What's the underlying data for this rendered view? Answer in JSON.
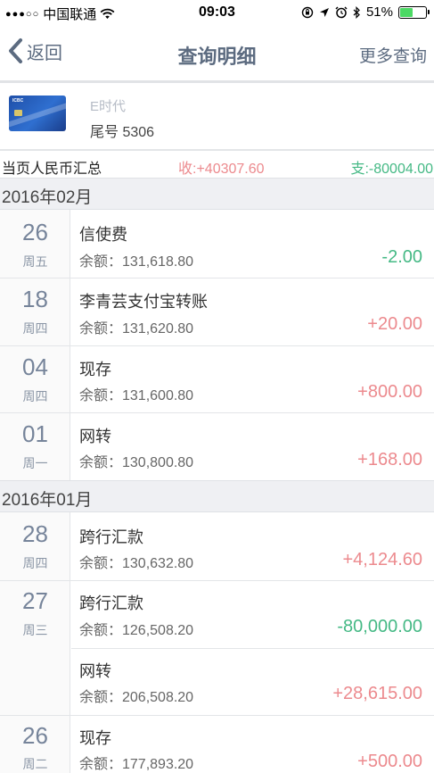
{
  "status_bar": {
    "signal": "●●●○○",
    "carrier": "中国联通",
    "time": "09:03",
    "battery_text": "51%",
    "battery_level": 0.51,
    "battery_color": "#4cd964"
  },
  "nav": {
    "back_label": "返回",
    "title": "查询明细",
    "more_label": "更多查询"
  },
  "card": {
    "name": "E时代",
    "tail": "尾号 5306",
    "logo_text": "ICBC"
  },
  "summary": {
    "label": "当页人民币汇总",
    "income": "收:+40307.60",
    "expense": "支:-80004.00"
  },
  "months": {
    "feb": "2016年02月",
    "jan": "2016年01月"
  },
  "transactions": [
    {
      "day": "26",
      "weekday": "周五",
      "title": "信使费",
      "balance": "余额：131,618.80",
      "amount": "-2.00"
    },
    {
      "day": "18",
      "weekday": "周四",
      "title": "李青芸支付宝转账",
      "balance": "余额：131,620.80",
      "amount": "+20.00"
    },
    {
      "day": "04",
      "weekday": "周四",
      "title": "现存",
      "balance": "余额：131,600.80",
      "amount": "+800.00"
    },
    {
      "day": "01",
      "weekday": "周一",
      "title": "网转",
      "balance": "余额：130,800.80",
      "amount": "+168.00"
    },
    {
      "day": "28",
      "weekday": "周四",
      "title": "跨行汇款",
      "balance": "余额：130,632.80",
      "amount": "+4,124.60"
    },
    {
      "day": "27",
      "weekday": "周三",
      "title": "跨行汇款",
      "balance": "余额：126,508.20",
      "amount": "-80,000.00"
    },
    {
      "day": "",
      "weekday": "",
      "title": "网转",
      "balance": "余额：206,508.20",
      "amount": "+28,615.00"
    },
    {
      "day": "26",
      "weekday": "周二",
      "title": "现存",
      "balance": "余额：177,893.20",
      "amount": "+500.00"
    }
  ],
  "colors": {
    "income": "#ec8a8e",
    "expense": "#45b985",
    "accent": "#5c6b80"
  }
}
